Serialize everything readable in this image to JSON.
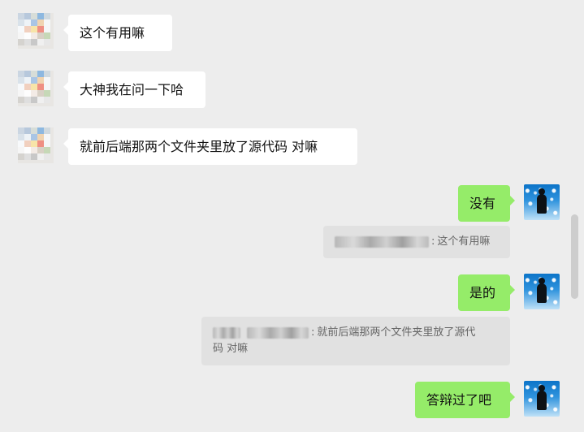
{
  "messages": [
    {
      "id": "m1",
      "side": "left",
      "text": "这个有用嘛"
    },
    {
      "id": "m2",
      "side": "left",
      "text": "大神我在问一下哈"
    },
    {
      "id": "m3",
      "side": "left",
      "text": "就前后端那两个文件夹里放了源代码 对嘛"
    },
    {
      "id": "m4",
      "side": "right",
      "text": "没有",
      "quote": {
        "text": "这个有用嘛"
      }
    },
    {
      "id": "m5",
      "side": "right",
      "text": "是的",
      "quote": {
        "text_line1": "就前后端那两个文件夹里放了源代",
        "text_line2": "码 对嘛"
      }
    },
    {
      "id": "m6",
      "side": "right",
      "text": "答辩过了吧"
    }
  ]
}
